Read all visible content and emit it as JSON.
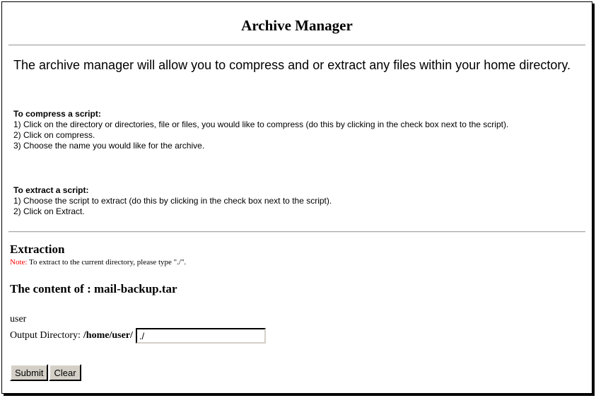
{
  "page": {
    "title": "Archive Manager",
    "intro": "The archive manager will allow you to compress and or extract any files within your home directory."
  },
  "compress": {
    "heading": "To compress a script:",
    "steps": [
      "1) Click on the directory or directories, file or files, you would like to compress (do this by clicking in the check box next to the script).",
      "2) Click on compress.",
      "3) Choose the name you would like for the archive."
    ]
  },
  "extract": {
    "heading": "To extract a script:",
    "steps": [
      "1) Choose the script to extract (do this by clicking in the check box next to the script).",
      "2) Click on Extract."
    ]
  },
  "extraction": {
    "heading": "Extraction",
    "note_label": "Note:",
    "note_text": " To extract to the current directory, please type \"./\".",
    "content_prefix": "The content of : ",
    "archive_name": "mail-backup.tar",
    "entry": "user",
    "output_label": "Output Directory:",
    "output_path": "/home/user/",
    "output_value": "./",
    "submit_label": "Submit",
    "clear_label": "Clear"
  }
}
